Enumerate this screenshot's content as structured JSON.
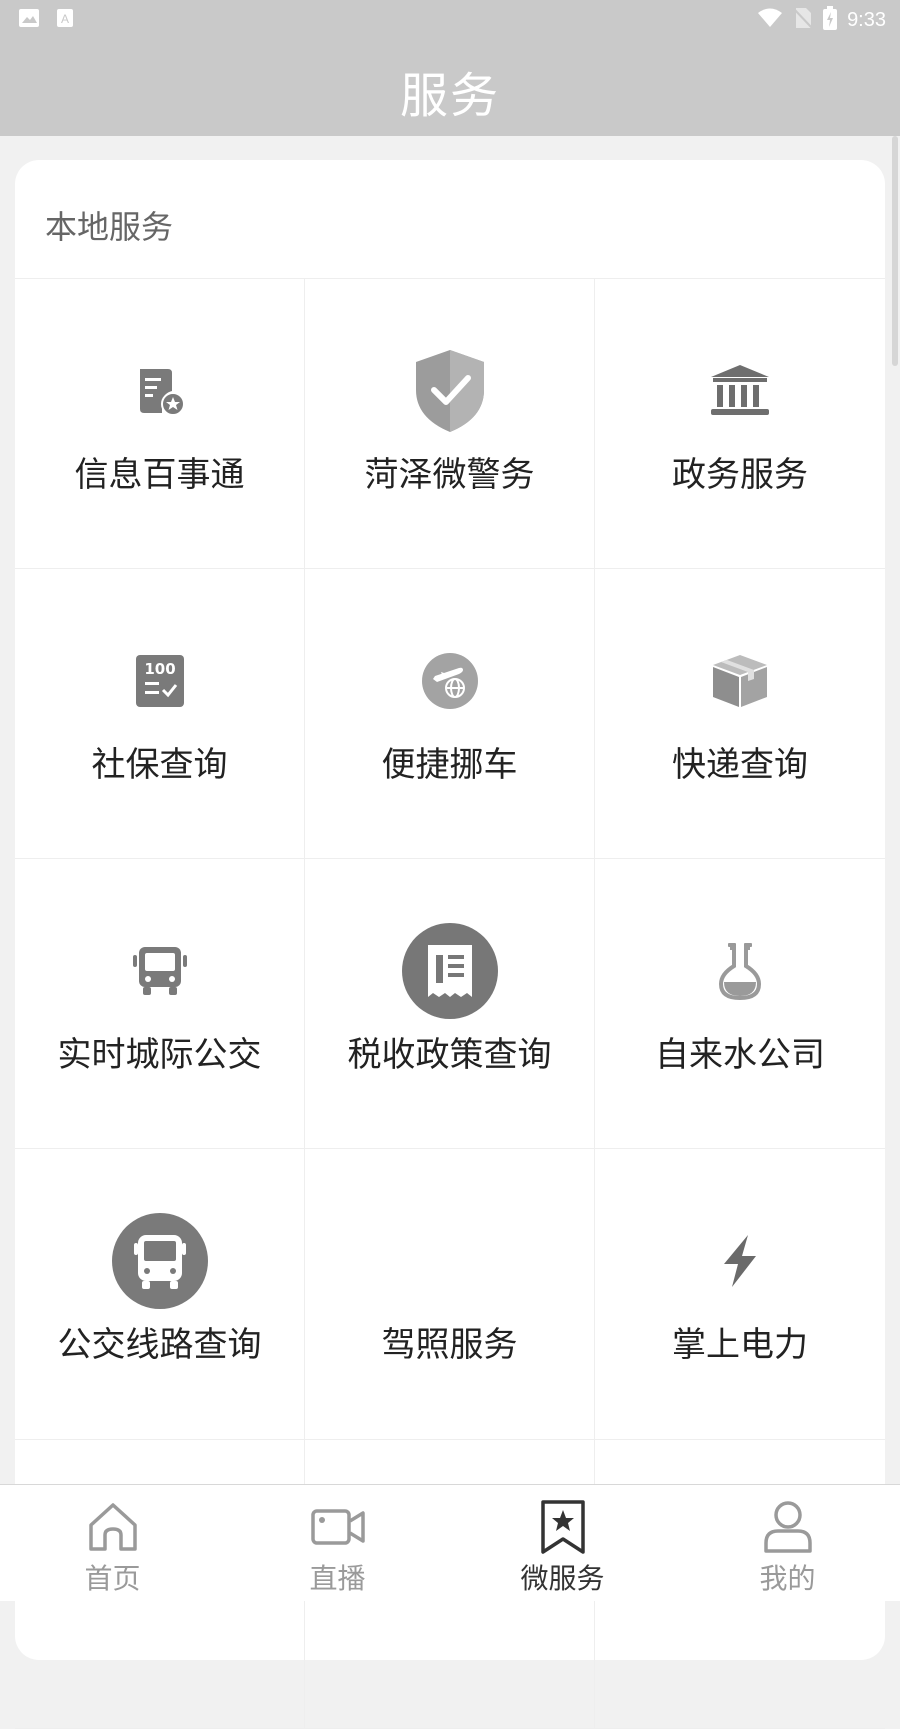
{
  "statusbar": {
    "time": "9:33"
  },
  "header": {
    "title": "服务"
  },
  "section": {
    "title": "本地服务"
  },
  "services": [
    {
      "label": "信息百事通",
      "icon": "document-star-icon"
    },
    {
      "label": "菏泽微警务",
      "icon": "shield-check-icon"
    },
    {
      "label": "政务服务",
      "icon": "government-building-icon"
    },
    {
      "label": "社保查询",
      "icon": "score-checklist-icon"
    },
    {
      "label": "便捷挪车",
      "icon": "airplane-globe-icon"
    },
    {
      "label": "快递查询",
      "icon": "package-box-icon"
    },
    {
      "label": "实时城际公交",
      "icon": "bus-icon"
    },
    {
      "label": "税收政策查询",
      "icon": "receipt-circle-icon"
    },
    {
      "label": "自来水公司",
      "icon": "flask-icon"
    },
    {
      "label": "公交线路查询",
      "icon": "bus-circle-icon"
    },
    {
      "label": "驾照服务",
      "icon": ""
    },
    {
      "label": "掌上电力",
      "icon": "lightning-icon"
    }
  ],
  "nav": [
    {
      "label": "首页",
      "icon": "home-icon",
      "active": false
    },
    {
      "label": "直播",
      "icon": "video-camera-icon",
      "active": false
    },
    {
      "label": "微服务",
      "icon": "bookmark-star-icon",
      "active": true
    },
    {
      "label": "我的",
      "icon": "user-icon",
      "active": false
    }
  ],
  "colors": {
    "header_bg": "#c9c9c9",
    "icon_gray": "#7a7a7a",
    "active_text": "#333333",
    "inactive_text": "#9a9a9a"
  }
}
